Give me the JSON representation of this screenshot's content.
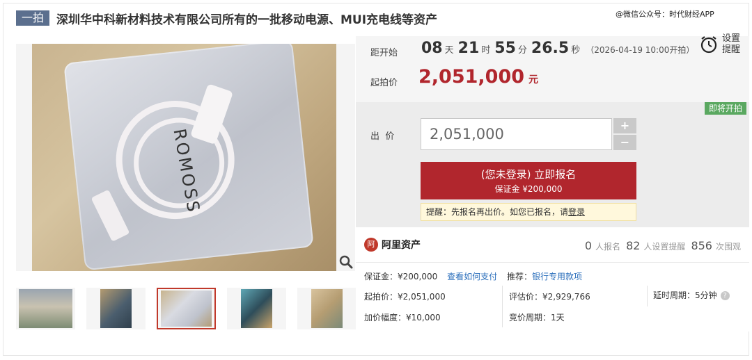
{
  "title": {
    "tag": "一拍",
    "text": "深圳华中科新材料技术有限公司所有的一批移动电源、MUI充电线等资产"
  },
  "watermark": "@微信公众号：时代财经APP",
  "gallery": {
    "brand_on_product": "ROMOSS",
    "zoom_icon": "magnifier-icon",
    "thumbnails": [
      {
        "name": "thumb-warehouse"
      },
      {
        "name": "thumb-box-powerbank"
      },
      {
        "name": "thumb-cable-bag",
        "active": true
      },
      {
        "name": "thumb-cable-boxes"
      },
      {
        "name": "thumb-carton"
      }
    ]
  },
  "countdown": {
    "label": "距开始",
    "days": "08",
    "days_unit": "天",
    "hours": "21",
    "hours_unit": "时",
    "minutes": "55",
    "minutes_unit": "分",
    "seconds": "26.5",
    "seconds_unit": "秒",
    "start_time": "（2026-04-19 10:00开拍）"
  },
  "reminder": {
    "line1": "设置",
    "line2": "提醒",
    "icon": "alarm-clock-icon"
  },
  "start_price": {
    "label": "起拍价",
    "value": "2,051,000",
    "unit": "元"
  },
  "bid": {
    "status": "即将开拍",
    "label": "出  价",
    "value": "2,051,000",
    "plus": "+",
    "minus": "−",
    "signup_main": "(您未登录) 立即报名",
    "signup_sub": "保证金 ¥200,000",
    "notice_text": "提醒：先报名再出价。如您已报名，请",
    "notice_link": "登录"
  },
  "platform": {
    "logo_text": "阿里资产",
    "logo_mark": "阿"
  },
  "stats": [
    {
      "value": "0",
      "label": "人报名"
    },
    {
      "value": "82",
      "label": "人设置提醒"
    },
    {
      "value": "856",
      "label": "次围观"
    }
  ],
  "info": {
    "deposit": "保证金：¥200,000",
    "how_to_pay": "查看如何支付",
    "recommend_label": "推荐：",
    "recommend_link": "银行专用款项",
    "start_price": "起拍价：¥2,051,000",
    "appraisal": "评估价：¥2,929,766",
    "delay": "延时周期：5分钟",
    "increment": "加价幅度：¥10,000",
    "bid_period": "竞价周期：1天",
    "help_mark": "?"
  },
  "colors": {
    "accent_red": "#b1262d",
    "tag_blue": "#5b6f8e",
    "status_green": "#5aa860",
    "link_blue": "#2a6ebb"
  }
}
